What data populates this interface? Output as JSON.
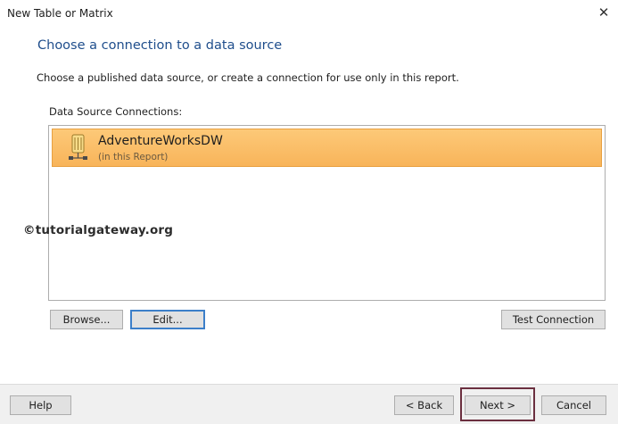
{
  "window": {
    "title": "New Table or Matrix",
    "close_glyph": "✕"
  },
  "heading": "Choose a connection to a data source",
  "instruction": "Choose a published data source, or create a connection for use only in this report.",
  "connections": {
    "label": "Data Source Connections:",
    "items": [
      {
        "name": "AdventureWorksDW",
        "location": "(in this Report)",
        "icon": "database-icon",
        "selected": true
      }
    ]
  },
  "watermark": "©tutorialgateway.org",
  "buttons": {
    "browse": "Browse...",
    "edit": "Edit...",
    "test_connection": "Test Connection",
    "help": "Help",
    "back": "< Back",
    "next": "Next >",
    "cancel": "Cancel"
  },
  "colors": {
    "heading": "#1f4e8c",
    "selection": "#f8b45a",
    "focus_border": "#3c7fc9",
    "next_highlight": "#6b2f3f"
  }
}
